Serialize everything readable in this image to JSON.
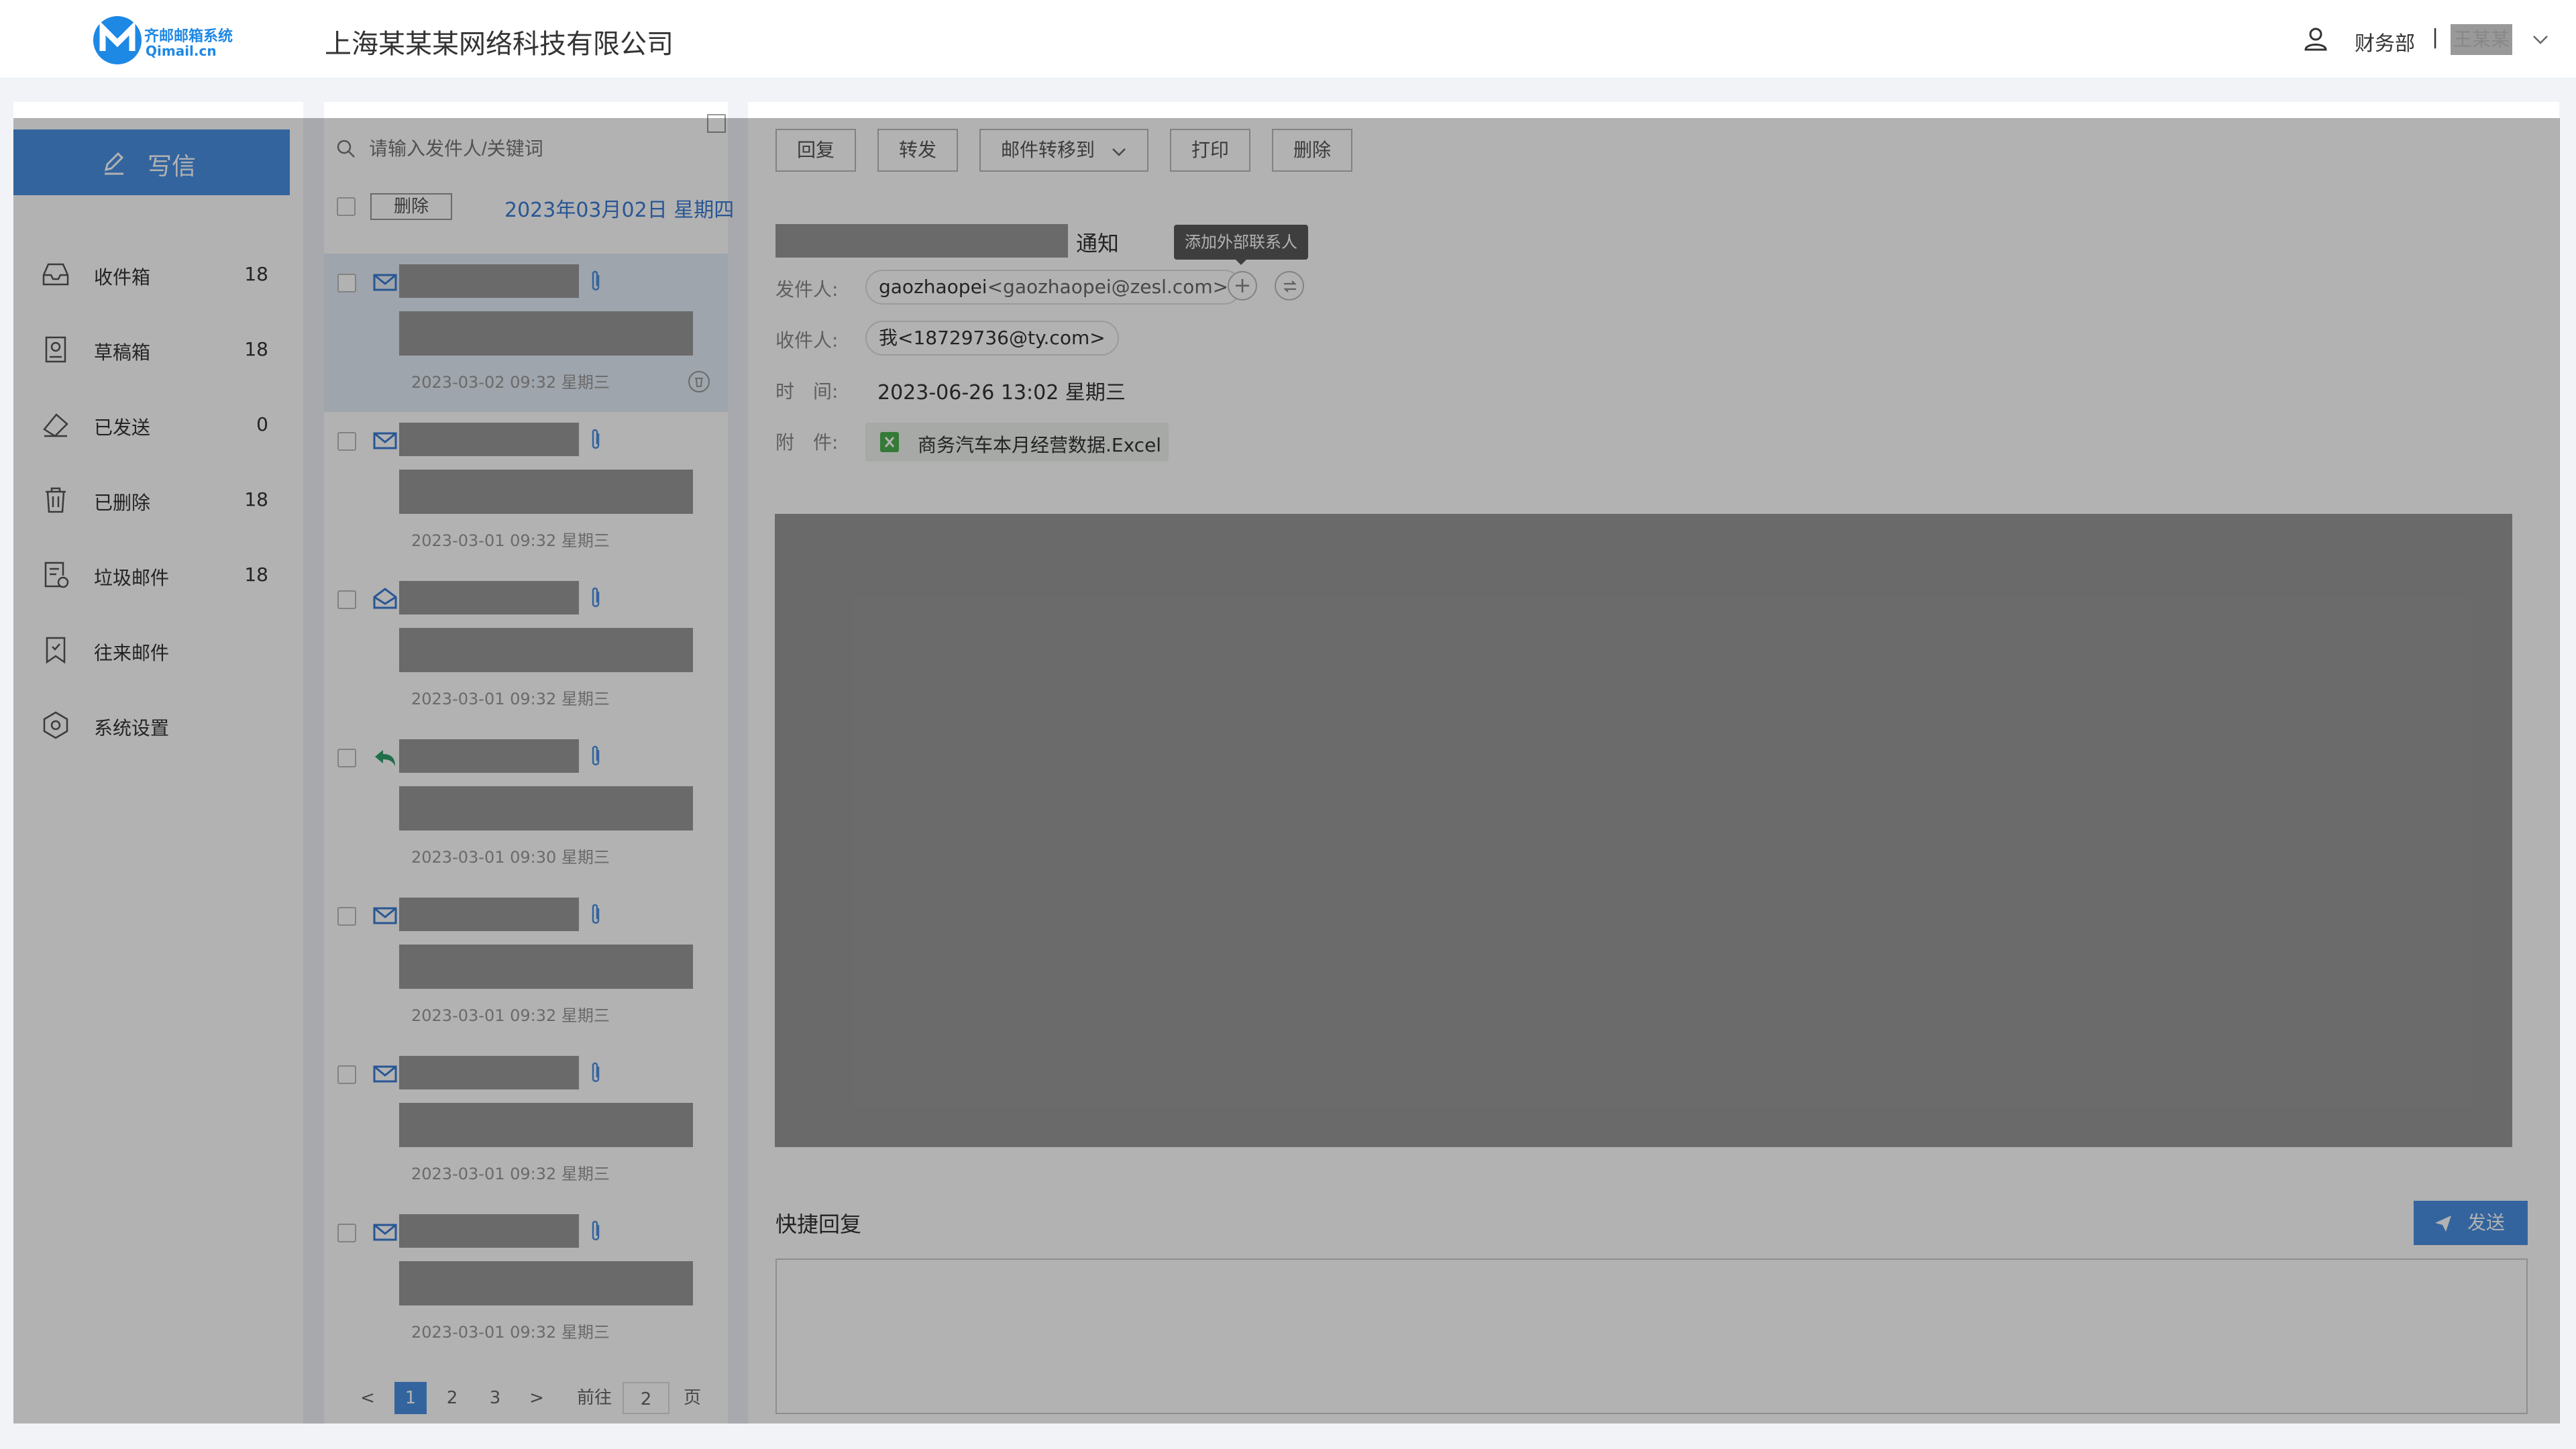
{
  "header": {
    "logo_text_cn": "齐邮邮箱系统",
    "logo_text_en": "Qimail.cn",
    "company": "上海某某某网络科技有限公司",
    "department": "财务部",
    "separator": "|",
    "username": "王某某"
  },
  "sidebar": {
    "compose_label": "写信",
    "items": [
      {
        "label": "收件箱",
        "count": "18",
        "icon": "inbox-icon"
      },
      {
        "label": "草稿箱",
        "count": "18",
        "icon": "draft-icon"
      },
      {
        "label": "已发送",
        "count": "0",
        "icon": "sent-icon"
      },
      {
        "label": "已删除",
        "count": "18",
        "icon": "trash-icon"
      },
      {
        "label": "垃圾邮件",
        "count": "18",
        "icon": "spam-icon"
      },
      {
        "label": "往来邮件",
        "count": "",
        "icon": "bookmark-icon"
      },
      {
        "label": "系统设置",
        "count": "",
        "icon": "settings-icon"
      }
    ]
  },
  "mail_list": {
    "search_placeholder": "请输入发件人/关键词",
    "delete_label": "删除",
    "date_header": "2023年03月02日 星期四",
    "items": [
      {
        "time": "2023-03-02 09:32 星期三",
        "icon": "mail-icon",
        "selected": true
      },
      {
        "time": "2023-03-01 09:32 星期三",
        "icon": "mail-icon"
      },
      {
        "time": "2023-03-01 09:32 星期三",
        "icon": "mail-open-icon"
      },
      {
        "time": "2023-03-01 09:30 星期三",
        "icon": "reply-icon"
      },
      {
        "time": "2023-03-01 09:32 星期三",
        "icon": "mail-icon"
      },
      {
        "time": "2023-03-01 09:32 星期三",
        "icon": "mail-icon"
      },
      {
        "time": "2023-03-01 09:32 星期三",
        "icon": "mail-icon"
      }
    ],
    "pagination": {
      "prev": "<",
      "pages": [
        "1",
        "2",
        "3"
      ],
      "current": "1",
      "next": ">",
      "goto_label": "前往",
      "goto_value": "2",
      "page_suffix": "页"
    }
  },
  "reader": {
    "toolbar": {
      "reply": "回复",
      "forward": "转发",
      "move_to": "邮件转移到",
      "print": "打印",
      "delete": "删除"
    },
    "subject_suffix": "通知",
    "tooltip": "添加外部联系人",
    "from_label": "发件人:",
    "from_name": "gaozhaopei",
    "from_email": "<gaozhaopei@zesl.com>",
    "to_label": "收件人:",
    "to_value": "我<18729736@ty.com>",
    "time_label": "时　间:",
    "time_value": "2023-06-26 13:02 星期三",
    "attachment_label": "附　件:",
    "attachment_name": "商务汽车本月经营数据.Excel",
    "add_contact_symbol": "+"
  },
  "quick_reply": {
    "title": "快捷回复",
    "send_label": "发送"
  },
  "colors": {
    "accent": "#4a90e2",
    "overlay": "rgba(0,0,0,0.30)"
  }
}
